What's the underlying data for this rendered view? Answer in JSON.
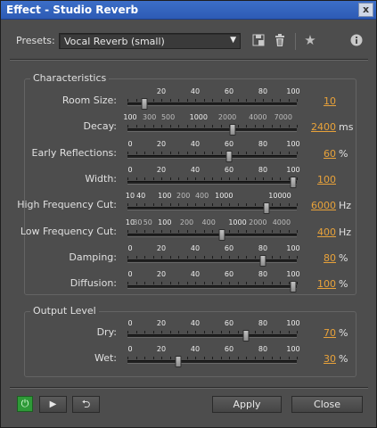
{
  "window": {
    "title": "Effect - Studio Reverb",
    "close_glyph": "x"
  },
  "presets": {
    "label": "Presets:",
    "selected": "Vocal Reverb (small)",
    "icons": [
      "save-preset-icon",
      "delete-preset-icon",
      "favorite-star-icon",
      "info-icon"
    ]
  },
  "characteristics": {
    "title": "Characteristics",
    "sliders": [
      {
        "label": "Room Size:",
        "value": "10",
        "unit": "",
        "position": 0.1,
        "scale": [
          {
            "t": "20",
            "p": 0.2
          },
          {
            "t": "40",
            "p": 0.4
          },
          {
            "t": "60",
            "p": 0.6
          },
          {
            "t": "80",
            "p": 0.8
          },
          {
            "t": "100",
            "p": 1.0
          }
        ]
      },
      {
        "label": "Decay:",
        "value": "2400",
        "unit": "ms",
        "position": 0.62,
        "scale": [
          {
            "t": "100",
            "p": 0.0
          },
          {
            "t": "300",
            "p": 0.13,
            "dim": true
          },
          {
            "t": "500",
            "p": 0.24,
            "dim": true
          },
          {
            "t": "1000",
            "p": 0.42
          },
          {
            "t": "2000",
            "p": 0.59,
            "dim": true
          },
          {
            "t": "4000",
            "p": 0.77,
            "dim": true
          },
          {
            "t": "7000",
            "p": 0.92,
            "dim": true
          }
        ]
      },
      {
        "label": "Early Reflections:",
        "value": "60",
        "unit": "%",
        "position": 0.6,
        "scale": [
          {
            "t": "0",
            "p": 0.0
          },
          {
            "t": "20",
            "p": 0.2
          },
          {
            "t": "40",
            "p": 0.4
          },
          {
            "t": "60",
            "p": 0.6
          },
          {
            "t": "80",
            "p": 0.8
          },
          {
            "t": "100",
            "p": 1.0
          }
        ]
      },
      {
        "label": "Width:",
        "value": "100",
        "unit": "",
        "position": 1.0,
        "scale": [
          {
            "t": "0",
            "p": 0.0
          },
          {
            "t": "20",
            "p": 0.2
          },
          {
            "t": "40",
            "p": 0.4
          },
          {
            "t": "60",
            "p": 0.6
          },
          {
            "t": "80",
            "p": 0.8
          },
          {
            "t": "100",
            "p": 1.0
          }
        ]
      },
      {
        "label": "High Frequency Cut:",
        "value": "6000",
        "unit": "Hz",
        "position": 0.82,
        "scale": [
          {
            "t": "10",
            "p": 0.0
          },
          {
            "t": "40",
            "p": 0.08
          },
          {
            "t": "100",
            "p": 0.22
          },
          {
            "t": "200",
            "p": 0.33,
            "dim": true
          },
          {
            "t": "400",
            "p": 0.44,
            "dim": true
          },
          {
            "t": "1000",
            "p": 0.57
          },
          {
            "t": "10000",
            "p": 0.9
          }
        ]
      },
      {
        "label": "Low Frequency Cut:",
        "value": "400",
        "unit": "Hz",
        "position": 0.56,
        "scale": [
          {
            "t": "10",
            "p": 0.0
          },
          {
            "t": "30",
            "p": 0.06,
            "dim": true
          },
          {
            "t": "50",
            "p": 0.12,
            "dim": true
          },
          {
            "t": "100",
            "p": 0.22
          },
          {
            "t": "200",
            "p": 0.35,
            "dim": true
          },
          {
            "t": "400",
            "p": 0.48,
            "dim": true
          },
          {
            "t": "1000",
            "p": 0.65
          },
          {
            "t": "2000",
            "p": 0.77,
            "dim": true
          },
          {
            "t": "4000",
            "p": 0.91,
            "dim": true
          }
        ]
      },
      {
        "label": "Damping:",
        "value": "80",
        "unit": "%",
        "position": 0.8,
        "scale": [
          {
            "t": "0",
            "p": 0.0
          },
          {
            "t": "20",
            "p": 0.2
          },
          {
            "t": "40",
            "p": 0.4
          },
          {
            "t": "60",
            "p": 0.6
          },
          {
            "t": "80",
            "p": 0.8
          },
          {
            "t": "100",
            "p": 1.0
          }
        ]
      },
      {
        "label": "Diffusion:",
        "value": "100",
        "unit": "%",
        "position": 1.0,
        "scale": [
          {
            "t": "0",
            "p": 0.0
          },
          {
            "t": "20",
            "p": 0.2
          },
          {
            "t": "40",
            "p": 0.4
          },
          {
            "t": "60",
            "p": 0.6
          },
          {
            "t": "80",
            "p": 0.8
          },
          {
            "t": "100",
            "p": 1.0
          }
        ]
      }
    ]
  },
  "output": {
    "title": "Output Level",
    "sliders": [
      {
        "label": "Dry:",
        "value": "70",
        "unit": "%",
        "position": 0.7,
        "scale": [
          {
            "t": "0",
            "p": 0.0
          },
          {
            "t": "20",
            "p": 0.2
          },
          {
            "t": "40",
            "p": 0.4
          },
          {
            "t": "60",
            "p": 0.6
          },
          {
            "t": "80",
            "p": 0.8
          },
          {
            "t": "100",
            "p": 1.0
          }
        ]
      },
      {
        "label": "Wet:",
        "value": "30",
        "unit": "%",
        "position": 0.3,
        "scale": [
          {
            "t": "0",
            "p": 0.0
          },
          {
            "t": "20",
            "p": 0.2
          },
          {
            "t": "40",
            "p": 0.4
          },
          {
            "t": "60",
            "p": 0.6
          },
          {
            "t": "80",
            "p": 0.8
          },
          {
            "t": "100",
            "p": 1.0
          }
        ]
      }
    ]
  },
  "footer": {
    "apply": "Apply",
    "close": "Close",
    "icons": [
      "power-toggle-icon",
      "play-preview-icon",
      "loop-icon"
    ],
    "glyphs": {
      "power": "⏻",
      "play": "▶",
      "loop": "⮌"
    }
  },
  "colors": {
    "value": "#e8a23a",
    "panel": "#4d4d4d",
    "titlebar": "#2d5bb5",
    "power_on": "#2e9a38"
  }
}
